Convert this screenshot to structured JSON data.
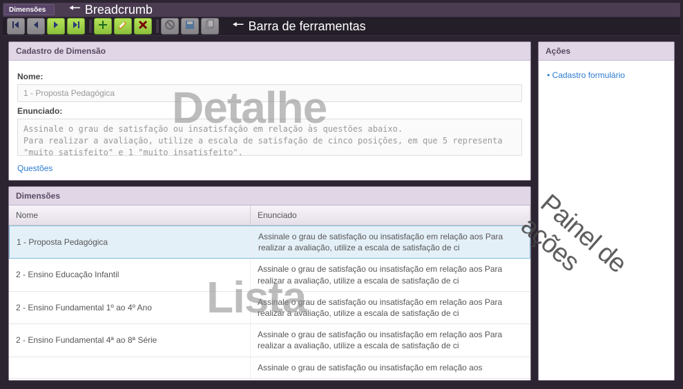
{
  "annotations": {
    "breadcrumb": "Breadcrumb",
    "toolbar": "Barra de ferramentas",
    "detail_wm": "Detalhe",
    "list_wm": "Lista",
    "actions_wm": "Painel de ações"
  },
  "breadcrumb": {
    "item": "Dimensões"
  },
  "detail": {
    "title": "Cadastro de Dimensão",
    "name_label": "Nome:",
    "name_value": "1 - Proposta Pedagógica",
    "statement_label": "Enunciado:",
    "statement_value": "Assinale o grau de satisfação ou insatisfação em relação às questões abaixo.\nPara realizar a avaliação, utilize a escala de satisfação de cinco posições, em que 5 representa \"muito satisfeito\" e 1 \"muito insatisfeito\".",
    "questions_link": "Questões"
  },
  "list": {
    "title": "Dimensões",
    "columns": {
      "name": "Nome",
      "statement": "Enunciado"
    },
    "rows": [
      {
        "name": "1 - Proposta Pedagógica",
        "statement": "Assinale o grau de satisfação ou insatisfação em relação aos\nPara realizar a avaliação, utilize a escala de satisfação de ci",
        "selected": true
      },
      {
        "name": "2 - Ensino Educação Infantil",
        "statement": "Assinale o grau de satisfação ou insatisfação em relação aos\nPara realizar a avaliação, utilize a escala de satisfação de ci",
        "selected": false
      },
      {
        "name": "2 - Ensino Fundamental 1º ao 4º Ano",
        "statement": "Assinale o grau de satisfação ou insatisfação em relação aos\nPara realizar a avaliação, utilize a escala de satisfação de ci",
        "selected": false
      },
      {
        "name": "2 - Ensino Fundamental 4ª ao 8ª Série",
        "statement": "Assinale o grau de satisfação ou insatisfação em relação aos\nPara realizar a avaliação, utilize a escala de satisfação de ci",
        "selected": false
      },
      {
        "name": "",
        "statement": "Assinale o grau de satisfação ou insatisfação em relação aos",
        "selected": false
      }
    ]
  },
  "actions": {
    "title": "Ações",
    "links": [
      "Cadastro formulário"
    ]
  },
  "toolbar_icons": [
    {
      "name": "first-icon",
      "disabled": true
    },
    {
      "name": "prev-icon",
      "disabled": true
    },
    {
      "name": "next-icon",
      "disabled": false
    },
    {
      "name": "last-icon",
      "disabled": false
    },
    {
      "sep": true
    },
    {
      "name": "add-icon",
      "disabled": false
    },
    {
      "name": "edit-icon",
      "disabled": false
    },
    {
      "name": "delete-icon",
      "disabled": false
    },
    {
      "sep": true
    },
    {
      "name": "cancel-icon",
      "disabled": true
    },
    {
      "name": "save-icon",
      "disabled": true
    },
    {
      "name": "copy-icon",
      "disabled": true
    }
  ]
}
